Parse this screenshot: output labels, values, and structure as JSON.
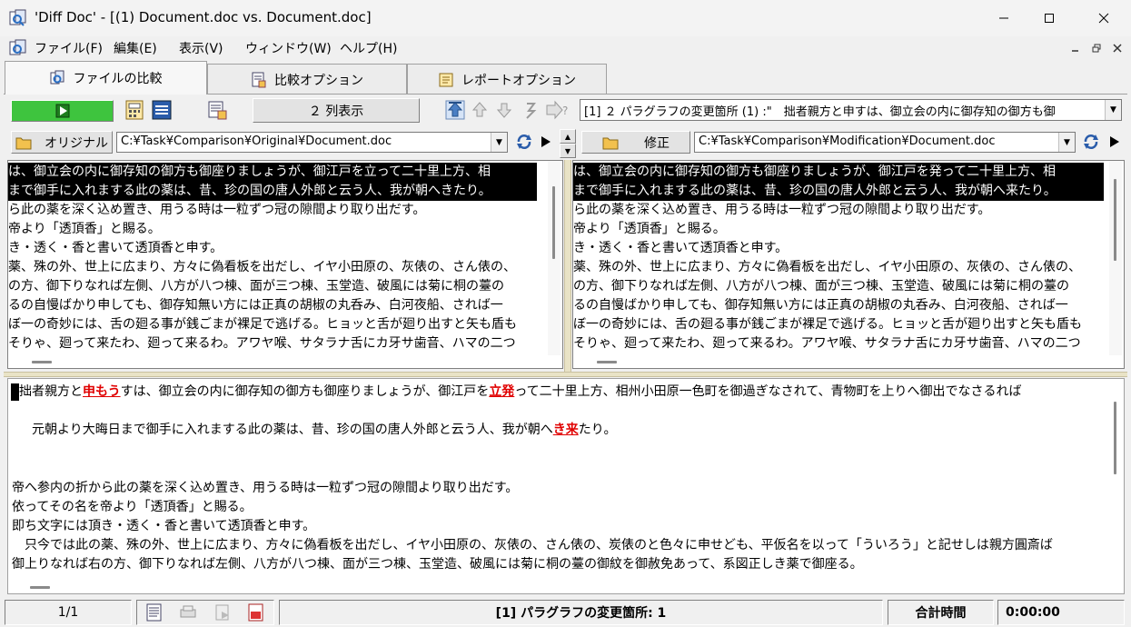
{
  "window": {
    "title": "'Diff Doc' - [(1) Document.doc vs. Document.doc]"
  },
  "menu": [
    "ファイル(F)",
    "編集(E)",
    "表示(V)",
    "ウィンドウ(W)",
    "ヘルプ(H)"
  ],
  "tabs": [
    "ファイルの比較",
    "比較オプション",
    "レポートオプション"
  ],
  "toolbar": {
    "columns_label": "２ 列表示",
    "change_select": "[1] ２ パラグラフの変更箇所 (1) :\"　拙者親方と申すは、御立会の内に御存知の御方も御"
  },
  "original": {
    "label": "オリジナル",
    "path": "C:¥Task¥Comparison¥Original¥Document.doc",
    "lines": [
      "は、御立会の内に御存知の御方も御座りましょうが、御江戸を立って二十里上方、相",
      "まで御手に入れまする此の薬は、昔、珍の国の唐人外郎と云う人、我が朝へきたり。",
      "ら此の薬を深く込め置き、用うる時は一粒ずつ冠の隙間より取り出だす。",
      "帝より「透頂香」と賜る。",
      "き・透く・香と書いて透頂香と申す。",
      "薬、殊の外、世上に広まり、方々に偽看板を出だし、イヤ小田原の、灰俵の、さん俵の、",
      "の方、御下りなれば左側、八方が八つ棟、面が三つ棟、玉堂造、破風には菊に桐の薹の",
      "るの自慢ばかり申しても、御存知無い方には正真の胡椒の丸呑み、白河夜船、されば一",
      "ぼ一の奇妙には、舌の廻る事が銭ごまが裸足で逃げる。ヒョッと舌が廻り出すと矢も盾も",
      "そりゃ、廻って来たわ、廻って来るわ。アワヤ喉、サタラナ舌にカ牙サ歯音、ハマの二つ"
    ]
  },
  "modified": {
    "label": "修正",
    "path": "C:¥Task¥Comparison¥Modification¥Document.doc",
    "lines": [
      "は、御立会の内に御存知の御方も御座りましょうが、御江戸を発って二十里上方、相",
      "まで御手に入れまする此の薬は、昔、珍の国の唐人外郎と云う人、我が朝へ来たり。",
      "ら此の薬を深く込め置き、用うる時は一粒ずつ冠の隙間より取り出だす。",
      "帝より「透頂香」と賜る。",
      "き・透く・香と書いて透頂香と申す。",
      "薬、殊の外、世上に広まり、方々に偽看板を出だし、イヤ小田原の、灰俵の、さん俵の、",
      "の方、御下りなれば左側、八方が八つ棟、面が三つ棟、玉堂造、破風には菊に桐の薹の",
      "るの自慢ばかり申しても、御存知無い方には正真の胡椒の丸呑み、白河夜船、されば一",
      "ぼ一の奇妙には、舌の廻る事が銭ごまが裸足で逃げる。ヒョッと舌が廻り出すと矢も盾も",
      "そりゃ、廻って来たわ、廻って来るわ。アワヤ喉、サタラナ舌にカ牙サ歯音、ハマの二つ"
    ]
  },
  "detail": {
    "line1": {
      "a": "拙者親方と",
      "b": "申もう",
      "c": "すは、御立会の内に御存知の御方も御座りましょうが、御江戸を",
      "d": "立発",
      "e": "って二十里上方、相州小田原一色町を御過ぎなされて、青物町を上りへ御出でなさるれば"
    },
    "line2": {
      "a": "　元朝より大晦日まで御手に入れまする此の薬は、昔、珍の国の唐人外郎と云う人、我が朝へ",
      "b": "き来",
      "c": "たり。"
    },
    "lines": [
      "帝へ参内の折から此の薬を深く込め置き、用うる時は一粒ずつ冠の隙間より取り出だす。",
      "依ってその名を帝より「透頂香」と賜る。",
      "即ち文字には頂き・透く・香と書いて透頂香と申す。",
      "　只今では此の薬、殊の外、世上に広まり、方々に偽看板を出だし、イヤ小田原の、灰俵の、さん俵の、炭俵のと色々に申せども、平仮名を以って「ういろう」と記せしは親方圓斎ば",
      "御上りなれば右の方、御下りなれば左側、八方が八つ棟、面が三つ棟、玉堂造、破風には菊に桐の薹の御紋を御赦免あって、系図正しき薬で御座る。"
    ]
  },
  "status": {
    "page": "1/1",
    "changes": "[1] パラグラフの変更箇所: 1",
    "total_time_label": "合計時間",
    "total_time": "0:00:00"
  },
  "colors": {
    "highlight": "#e00000",
    "play_green": "#3ec43e",
    "selection_bg": "#000000"
  }
}
